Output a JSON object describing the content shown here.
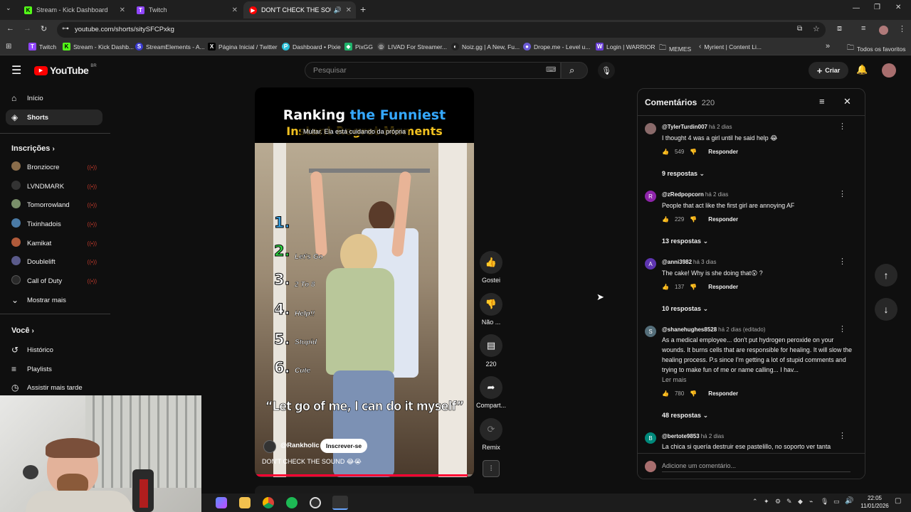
{
  "browser": {
    "tabs": [
      {
        "title": "Stream - Kick Dashboard",
        "favicon_color": "#53fc18"
      },
      {
        "title": "Twitch",
        "favicon_color": "#9146ff"
      },
      {
        "title": "DON'T CHECK THE SOUND",
        "favicon_color": "#ff0000"
      }
    ],
    "new_tab": "+",
    "url": "youtube.com/shorts/sitySFCPxkg",
    "bookmarks": [
      "Twitch",
      "Stream - Kick Dashb...",
      "StreamElements - A...",
      "Página Inicial / Twitter",
      "Dashboard • Pixie",
      "PixGG",
      "LIVAD For Streamer...",
      "Noiz.gg | A New, Fu...",
      "Drope.me - Level u...",
      "Login | WARRIOR",
      "MEMES",
      "Myrient | Content Li..."
    ],
    "bookmarks_more": "»",
    "all_favorites": "Todos os favoritos"
  },
  "youtube": {
    "logo": "YouTube",
    "region": "BR",
    "search_placeholder": "Pesquisar",
    "create_label": "Criar"
  },
  "sidebar": {
    "top": [
      {
        "label": "Início",
        "icon": "home-icon"
      },
      {
        "label": "Shorts",
        "icon": "shorts-icon"
      }
    ],
    "subscriptions_header": "Inscrições",
    "subscriptions": [
      {
        "label": "Bronziocre",
        "color": "#8a6d4b"
      },
      {
        "label": "LVNDMARK",
        "color": "#444"
      },
      {
        "label": "Tomorrowland",
        "color": "#7a8f6a"
      },
      {
        "label": "Tixinhadois",
        "color": "#4a7aa5"
      },
      {
        "label": "Kamikat",
        "color": "#b05a3a"
      },
      {
        "label": "Doublelift",
        "color": "#5a5a8a"
      },
      {
        "label": "Call of Duty",
        "color": "#2a2a2a"
      }
    ],
    "show_more": "Mostrar mais",
    "you_header": "Você",
    "you": [
      {
        "label": "Histórico",
        "icon": "history-icon"
      },
      {
        "label": "Playlists",
        "icon": "playlists-icon"
      },
      {
        "label": "Assistir mais tarde",
        "icon": "watch-later-icon"
      }
    ]
  },
  "video": {
    "title_line1a": "Ranking ",
    "title_line1b": "the Funniest",
    "title_line2": "Instant Regret Moments",
    "caption": "Multar. Ela está cuidando da própria",
    "ranks": [
      {
        "n": "1.",
        "text": "",
        "color": "#3aa0e0"
      },
      {
        "n": "2.",
        "text": "Let's Go",
        "color": "#2ecc40"
      },
      {
        "n": "3.",
        "text": "2 To 8",
        "color": "#ffffff"
      },
      {
        "n": "4.",
        "text": "Help!!",
        "color": "#ffffff"
      },
      {
        "n": "5.",
        "text": "Stupid",
        "color": "#ffffff"
      },
      {
        "n": "6.",
        "text": "Cute",
        "color": "#ffffff"
      }
    ],
    "quote": "“Let go of me, I can do it myself”",
    "channel": "@Rankholic",
    "subscribe": "Inscrever-se",
    "description": "DON'T CHECK THE SOUND 😂😭",
    "progress_fraction": 0.97
  },
  "actions": {
    "like": "Gostei",
    "dislike": "Não ...",
    "comments": "220",
    "share": "Compart...",
    "remix": "Remix"
  },
  "comments": {
    "title": "Comentários",
    "count": "220",
    "add_placeholder": "Adicione um comentário...",
    "items": [
      {
        "user": "@TylerTurdin007",
        "time": "há 2 dias",
        "text": "I thought 4 was a girl until he said help 😂",
        "likes": "549",
        "replies": "9 respostas",
        "avatar": "",
        "avatar_color": "#8a6a6a",
        "more": ""
      },
      {
        "user": "@zRedpopcorn",
        "time": "há 2 dias",
        "text": "People that act like the first girl are annoying AF",
        "likes": "229",
        "replies": "13 respostas",
        "avatar": "R",
        "avatar_color": "#8e24aa",
        "more": ""
      },
      {
        "user": "@anni3982",
        "time": "há 3 dias",
        "text": "The cake! Why is she doing that😮 ?",
        "likes": "137",
        "replies": "10 respostas",
        "avatar": "A",
        "avatar_color": "#5e35b1",
        "more": ""
      },
      {
        "user": "@shanehughes8528",
        "time": "há 2 dias (editado)",
        "text": "As a medical employee... don't put hydrogen peroxide on your wounds. It burns cells that are responsible for healing. It will slow the healing process. P.s since I'm getting a lot of stupid comments and trying to make fun of me or name calling... I hav...",
        "likes": "780",
        "replies": "48 respostas",
        "avatar": "S",
        "avatar_color": "#546e7a",
        "more": "Ler mais"
      },
      {
        "user": "@bertote9853",
        "time": "há 2 dias",
        "text": "La chica si quería destruir ese pastelillo, no soporto ver tanta",
        "likes": "",
        "replies": "",
        "avatar": "B",
        "avatar_color": "#00897b",
        "more": ""
      }
    ],
    "reply_label": "Responder"
  },
  "taskbar": {
    "time": "22:05",
    "date": "11/01/2026"
  }
}
